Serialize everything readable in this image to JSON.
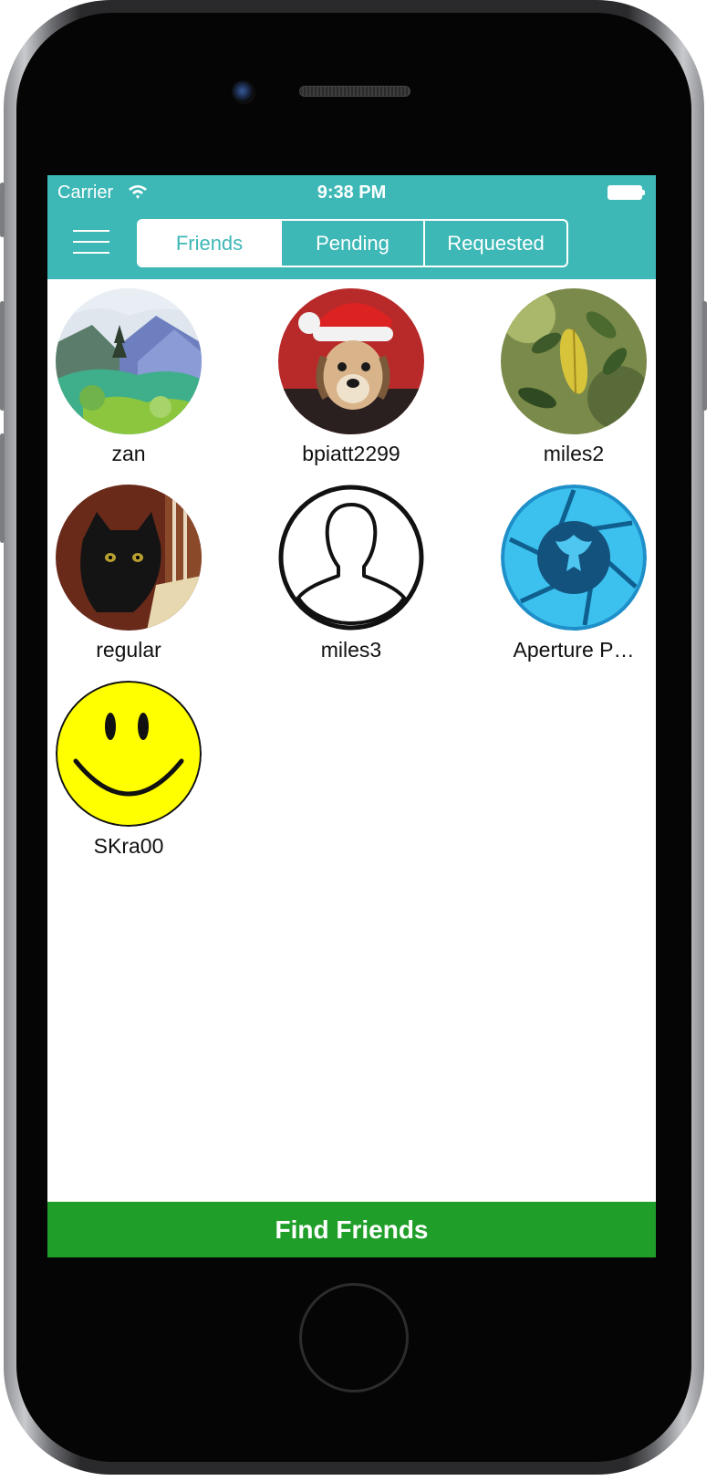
{
  "status_bar": {
    "carrier": "Carrier",
    "time": "9:38 PM",
    "wifi_icon": "wifi-icon",
    "battery_icon": "battery-icon"
  },
  "nav": {
    "menu_icon": "hamburger-menu-icon",
    "tabs": [
      {
        "label": "Friends",
        "active": true
      },
      {
        "label": "Pending",
        "active": false
      },
      {
        "label": "Requested",
        "active": false
      }
    ]
  },
  "friends": [
    {
      "name": "zan",
      "avatar": "landscape-painting"
    },
    {
      "name": "bpiatt2299",
      "avatar": "dog-santa-hat"
    },
    {
      "name": "miles2",
      "avatar": "leaves-photo"
    },
    {
      "name": "regular",
      "avatar": "black-cat-photo"
    },
    {
      "name": "miles3",
      "avatar": "default-person-icon"
    },
    {
      "name": "Aperture P…",
      "avatar": "aperture-logo"
    },
    {
      "name": "SKra00",
      "avatar": "smiley-face"
    }
  ],
  "footer": {
    "find_friends_label": "Find Friends"
  },
  "colors": {
    "nav_teal": "#3db8b6",
    "find_button_green": "#1f9f2a",
    "background": "#ffffff"
  }
}
